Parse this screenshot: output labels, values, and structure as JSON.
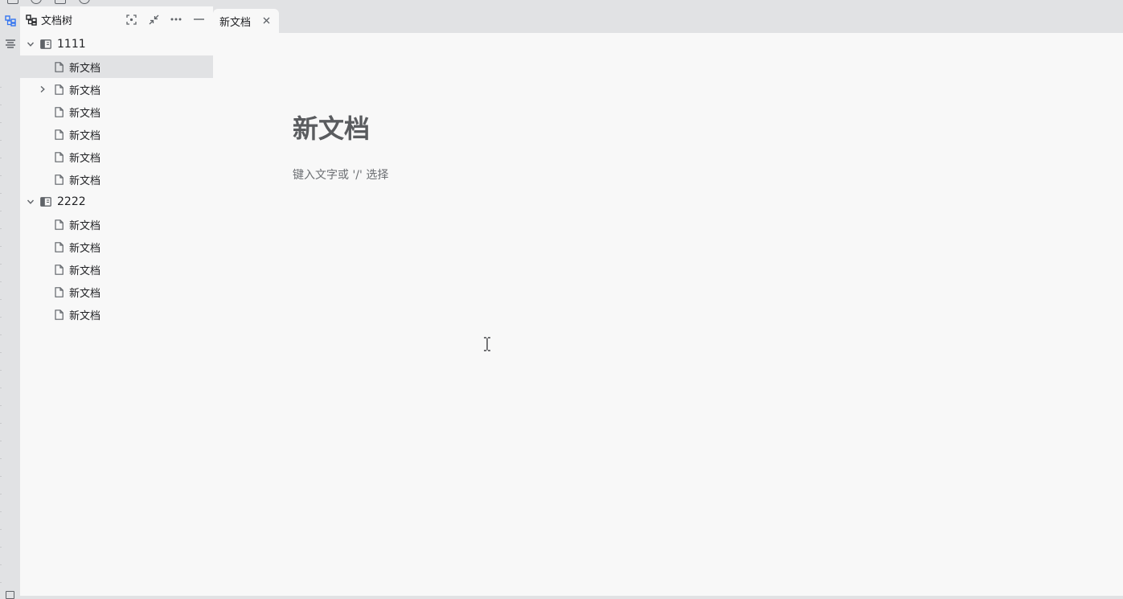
{
  "filetree": {
    "title": "文档树",
    "actions": [
      "focus-icon",
      "collapse-icon",
      "more-icon",
      "minimize-icon"
    ],
    "notebooks": [
      {
        "name": "1111",
        "expanded": true,
        "docs": [
          {
            "label": "新文档",
            "selected": true,
            "has_children": false
          },
          {
            "label": "新文档",
            "selected": false,
            "has_children": true
          },
          {
            "label": "新文档",
            "selected": false,
            "has_children": false
          },
          {
            "label": "新文档",
            "selected": false,
            "has_children": false
          },
          {
            "label": "新文档",
            "selected": false,
            "has_children": false
          },
          {
            "label": "新文档",
            "selected": false,
            "has_children": false
          }
        ]
      },
      {
        "name": "2222",
        "expanded": true,
        "docs": [
          {
            "label": "新文档",
            "selected": false,
            "has_children": false
          },
          {
            "label": "新文档",
            "selected": false,
            "has_children": false
          },
          {
            "label": "新文档",
            "selected": false,
            "has_children": false
          },
          {
            "label": "新文档",
            "selected": false,
            "has_children": false
          },
          {
            "label": "新文档",
            "selected": false,
            "has_children": false
          }
        ]
      }
    ]
  },
  "tabs": [
    {
      "label": "新文档",
      "active": true
    }
  ],
  "editor": {
    "title": "新文档",
    "placeholder": "键入文字或 '/' 选择"
  },
  "colors": {
    "chrome": "#e1e2e4",
    "panel": "#f8f8f8",
    "accent": "#3575f0",
    "title_text": "#5a5c5f"
  }
}
